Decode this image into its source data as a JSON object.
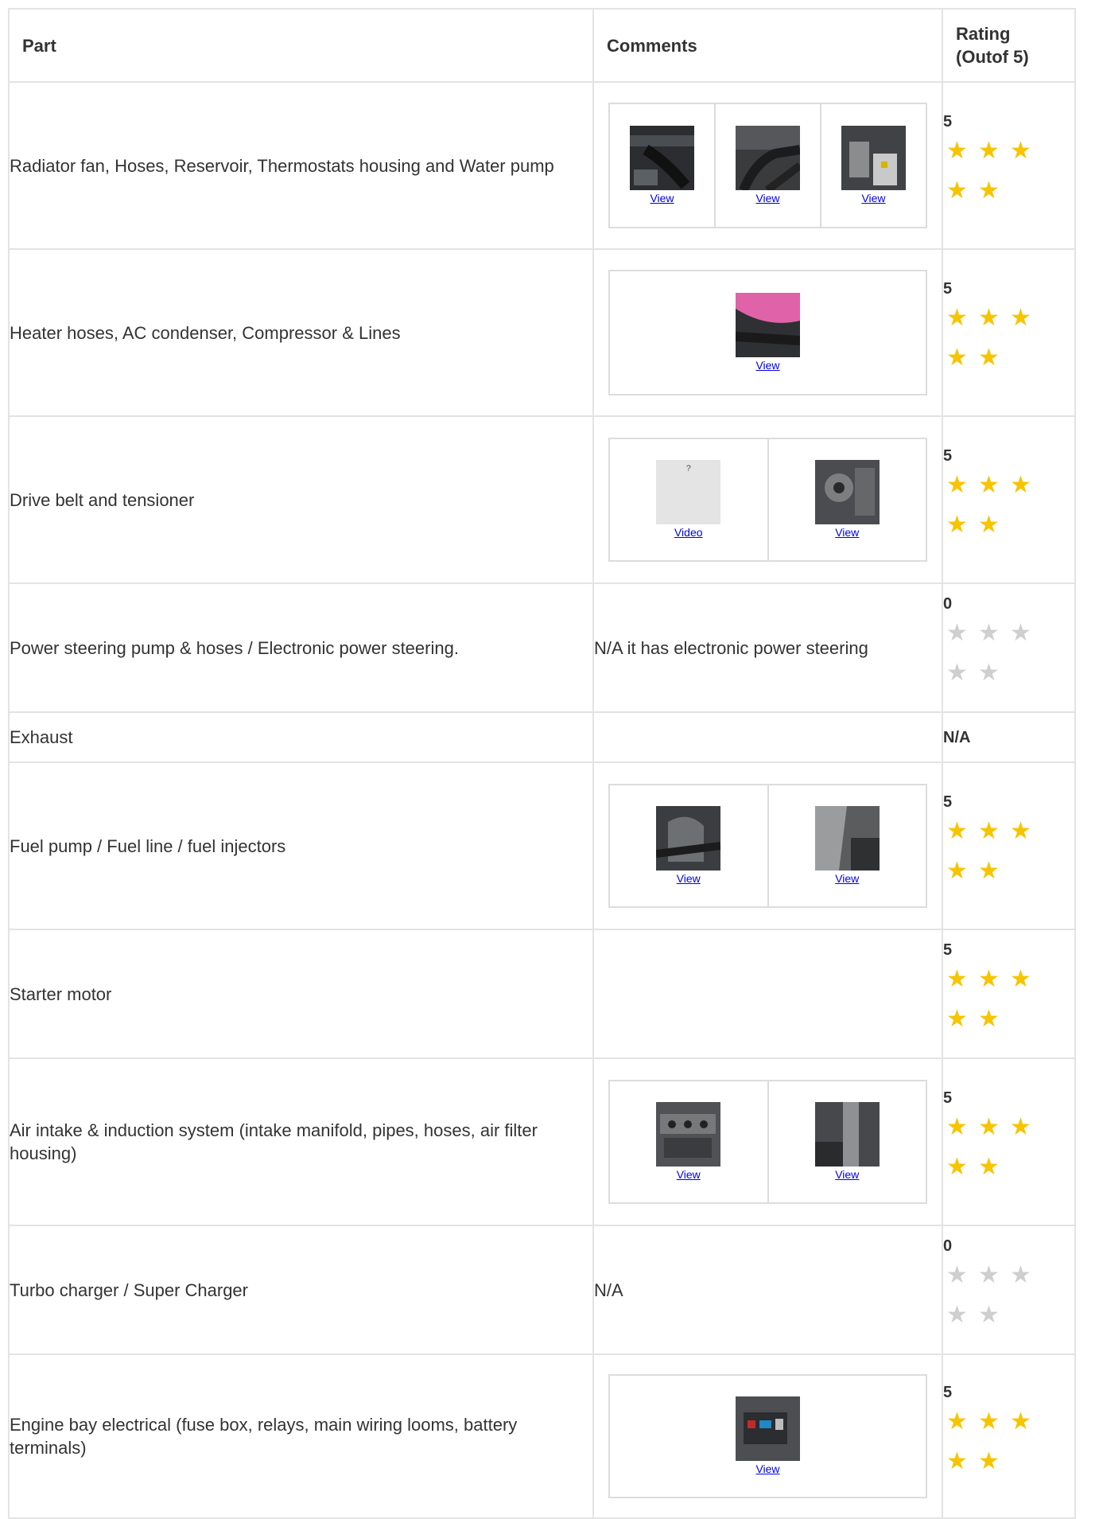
{
  "headers": {
    "part": "Part",
    "comments": "Comments",
    "rating": "Rating (Outof 5)"
  },
  "rows": [
    {
      "part": "Radiator fan, Hoses, Reservoir, Thermostats housing and Water pump",
      "comment": "",
      "rating": "5",
      "stars": 5,
      "media": [
        "View",
        "View",
        "View"
      ]
    },
    {
      "part": "Heater hoses, AC condenser, Compressor & Lines",
      "comment": "",
      "rating": "5",
      "stars": 5,
      "media": [
        "View"
      ]
    },
    {
      "part": "Drive belt and tensioner",
      "comment": "",
      "rating": "5",
      "stars": 5,
      "media": [
        "Video",
        "View"
      ],
      "placeholder_glyph": "?"
    },
    {
      "part": "Power steering pump & hoses / Electronic power steering.",
      "comment": "N/A it has electronic power steering",
      "rating": "0",
      "stars": 0
    },
    {
      "part": "Exhaust",
      "comment": "",
      "rating": "N/A"
    },
    {
      "part": "Fuel pump / Fuel line / fuel injectors",
      "comment": "",
      "rating": "5",
      "stars": 5,
      "media": [
        "View",
        "View"
      ]
    },
    {
      "part": "Starter motor",
      "comment": "",
      "rating": "5",
      "stars": 5
    },
    {
      "part": "Air intake & induction system (intake manifold, pipes, hoses, air filter housing)",
      "comment": "",
      "rating": "5",
      "stars": 5,
      "media": [
        "View",
        "View"
      ]
    },
    {
      "part": "Turbo charger / Super Charger",
      "comment": "N/A",
      "rating": "0",
      "stars": 0
    },
    {
      "part": "Engine bay electrical (fuse box, relays, main wiring looms, battery terminals)",
      "comment": "",
      "rating": "5",
      "stars": 5,
      "media": [
        "View"
      ]
    }
  ],
  "colors": {
    "star_on": "#f7c400",
    "star_off": "#cfcfcf",
    "link": "#0000ee",
    "border": "#e3e3e3"
  },
  "icons": {
    "star": "star-icon"
  }
}
